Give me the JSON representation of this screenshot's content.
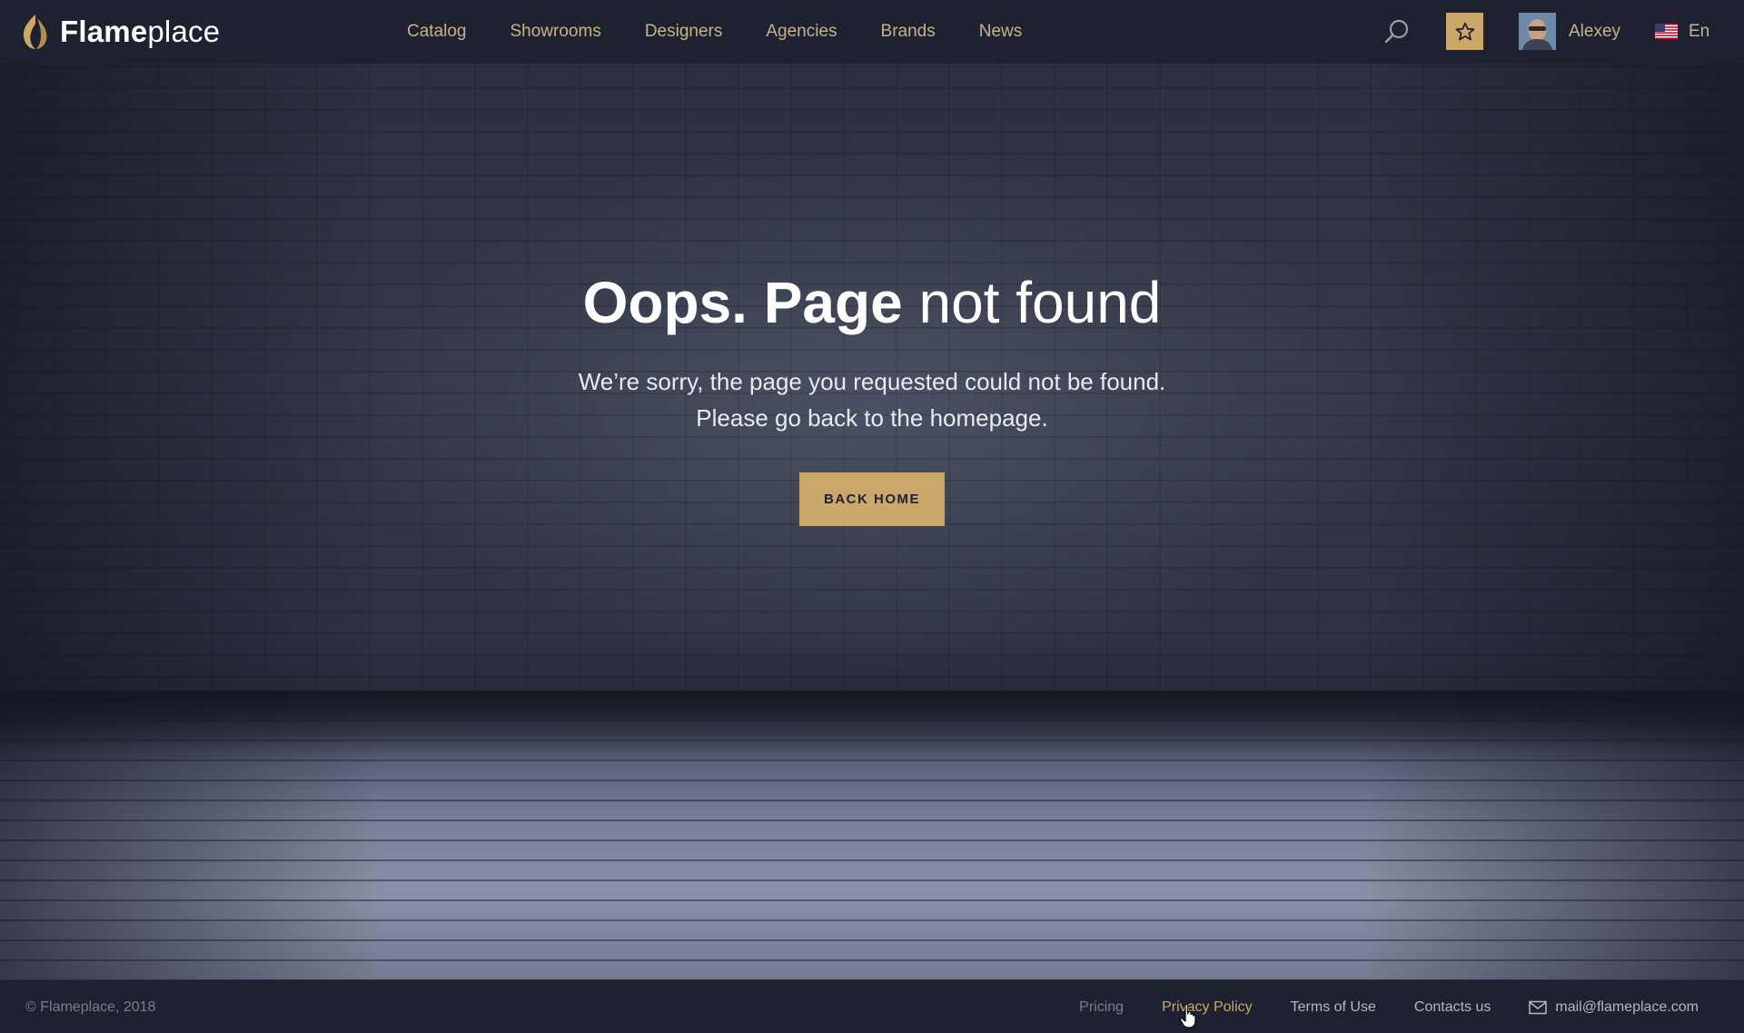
{
  "header": {
    "logo": {
      "bold": "Flame",
      "light": "place"
    },
    "nav": [
      "Catalog",
      "Showrooms",
      "Designers",
      "Agencies",
      "Brands",
      "News"
    ],
    "user_name": "Alexey",
    "language": "En",
    "icons": {
      "search": "search-icon",
      "favorites": "star-icon",
      "flag": "us-flag-icon"
    },
    "accent_color": "#c9a869"
  },
  "hero": {
    "title_bold": "Oops. Page",
    "title_light": "not found",
    "message_line1": "We’re sorry, the page you requested could not be found.",
    "message_line2": "Please go back to the homepage.",
    "button_label": "BACK HOME"
  },
  "footer": {
    "copyright": "© Flameplace, 2018",
    "links": [
      "Pricing",
      "Privacy Policy",
      "Terms of Use",
      "Contacts us"
    ],
    "email": "mail@flameplace.com"
  }
}
